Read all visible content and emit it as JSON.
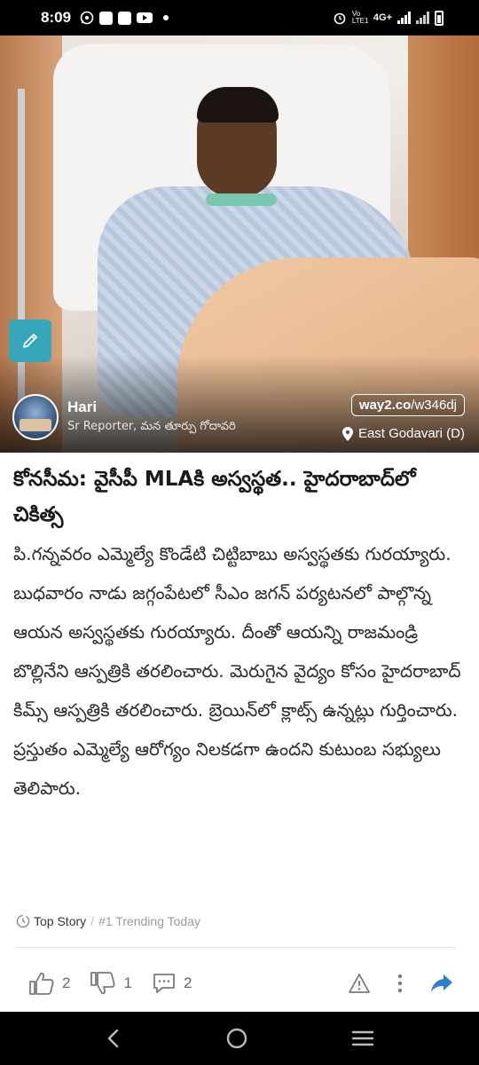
{
  "status_bar": {
    "time": "8:09",
    "network": "4G+",
    "volte": "Vo LTE1"
  },
  "hero": {
    "author_name": "Hari",
    "author_role": "Sr Reporter, మన తూర్పు గోదావరి",
    "shortlink_domain": "way2.co",
    "shortlink_path": "/w346dj",
    "location": "East Godavari (D)"
  },
  "article": {
    "headline": "కోనసీమ: వైసీపీ MLAకి అస్వస్థత.. హైదరాబాద్‌లో చికిత్స",
    "body": "పి.గన్నవరం ఎమ్మెల్యే కొండేటి చిట్టిబాబు అస్వస్థతకు గురయ్యారు. బుధవారం నాడు జగ్గంపేటలో సీఎం జగన్ పర్యటనలో పాల్గొన్న ఆయన అస్వస్థతకు గురయ్యారు. దీంతో ఆయన్ని రాజమండ్రి బొల్లినేని ఆస్పత్రికి తరలించారు. మెరుగైన వైద్యం కోసం హైదరాబాద్ కిమ్స్ ఆస్పత్రికి తరలించారు. బ్రెయిన్‌లో క్లాట్స్ ఉన్నట్లు గుర్తించారు. ప్రస్తుతం ఎమ్మెల్యే ఆరోగ్యం నిలకడగా ఉందని కుటుంబ సభ్యులు తెలిపారు."
  },
  "tags": {
    "top_story": "Top Story",
    "separator": "/",
    "trending": "#1 Trending Today"
  },
  "actions": {
    "likes": "2",
    "dislikes": "1",
    "comments": "2"
  },
  "colors": {
    "accent": "#2f7fd0",
    "edit_button": "#35a7b8"
  }
}
